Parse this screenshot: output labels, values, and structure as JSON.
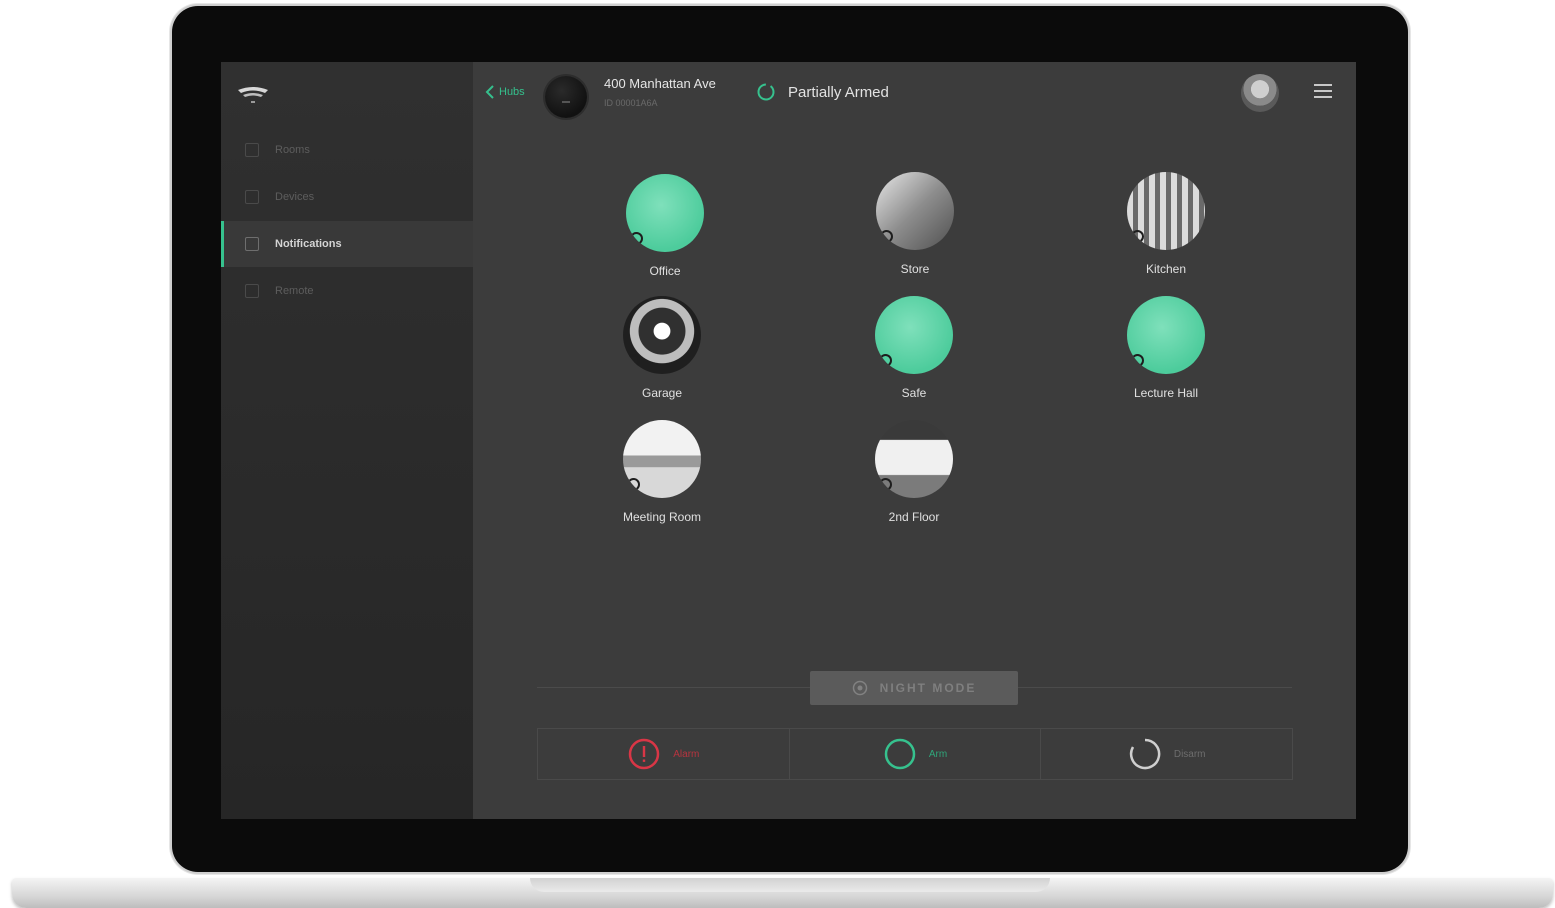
{
  "colors": {
    "accent": "#36c28e",
    "alarm": "#d93646",
    "disarm": "#cfcfcf"
  },
  "sidebar": {
    "logo_icon": "ajax-logo-icon",
    "items": [
      {
        "label": "Rooms",
        "icon": "rooms-icon",
        "active": false
      },
      {
        "label": "Devices",
        "icon": "devices-icon",
        "active": false
      },
      {
        "label": "Notifications",
        "icon": "notifications-icon",
        "active": true
      },
      {
        "label": "Remote",
        "icon": "remote-icon",
        "active": false
      }
    ]
  },
  "header": {
    "back_label": "Hubs",
    "hub_name": "400 Manhattan Ave",
    "hub_id": "ID 00001A6A",
    "status": "Partially Armed"
  },
  "rooms": [
    {
      "name": "Office",
      "armed": true
    },
    {
      "name": "Store",
      "armed": false
    },
    {
      "name": "Kitchen",
      "armed": false
    },
    {
      "name": "Garage",
      "armed": false
    },
    {
      "name": "Safe",
      "armed": true
    },
    {
      "name": "Lecture Hall",
      "armed": true
    },
    {
      "name": "Meeting Room",
      "armed": false
    },
    {
      "name": "2nd Floor",
      "armed": false
    }
  ],
  "night_mode": {
    "label": "NIGHT MODE"
  },
  "controls": {
    "alarm": "Alarm",
    "arm": "Arm",
    "disarm": "Disarm"
  }
}
